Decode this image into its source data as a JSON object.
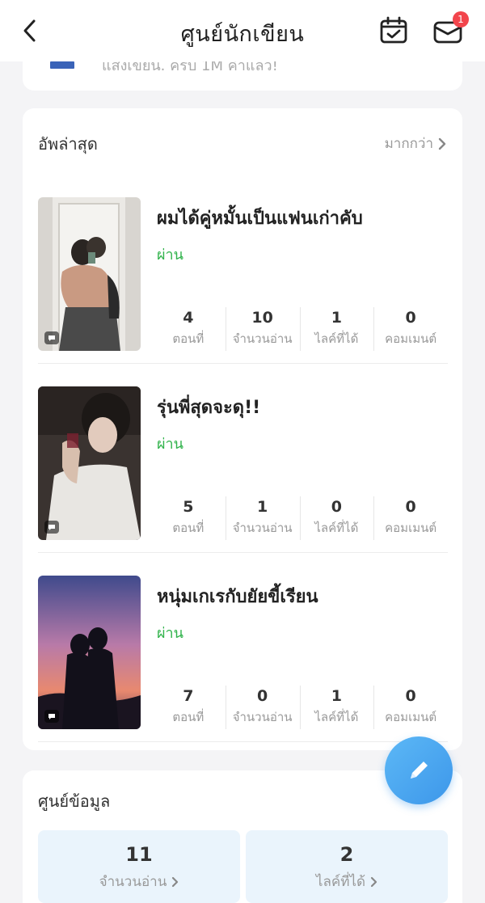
{
  "header": {
    "title": "ศูนย์นักเขียน",
    "notification_count": "1"
  },
  "top_card": {
    "partial_text": "แสงเขียน. ครบ 1M คำแล้ว!"
  },
  "updates": {
    "title": "อัพล่าสุด",
    "more_label": "มากกว่า",
    "stat_labels": [
      "ตอนที่",
      "จำนวนอ่าน",
      "ไลค์ที่ได้",
      "คอมเมนต์"
    ],
    "stories": [
      {
        "title": "ผมได้คู่หมั้นเป็นแฟนเก่าคับ",
        "status": "ผ่าน",
        "stats": [
          "4",
          "10",
          "1",
          "0"
        ]
      },
      {
        "title": "รุ่นพี่สุดจะดุ!!",
        "status": "ผ่าน",
        "stats": [
          "5",
          "1",
          "0",
          "0"
        ]
      },
      {
        "title": "หนุ่มเกเรกับยัยขี้เรียน",
        "status": "ผ่าน",
        "stats": [
          "7",
          "0",
          "1",
          "0"
        ]
      }
    ]
  },
  "info_center": {
    "title": "ศูนย์ข้อมูล",
    "reads_value": "11",
    "reads_label": "จำนวนอ่าน",
    "likes_value": "2",
    "likes_label": "ไลค์ที่ได้"
  },
  "colors": {
    "accent": "#3d97ea",
    "status_green": "#2fb24a",
    "badge_red": "#f2454c"
  },
  "icons": [
    "chevron-left-icon",
    "calendar-check-icon",
    "mail-icon",
    "chevron-right-icon",
    "chat-bubble-icon",
    "pencil-icon"
  ]
}
